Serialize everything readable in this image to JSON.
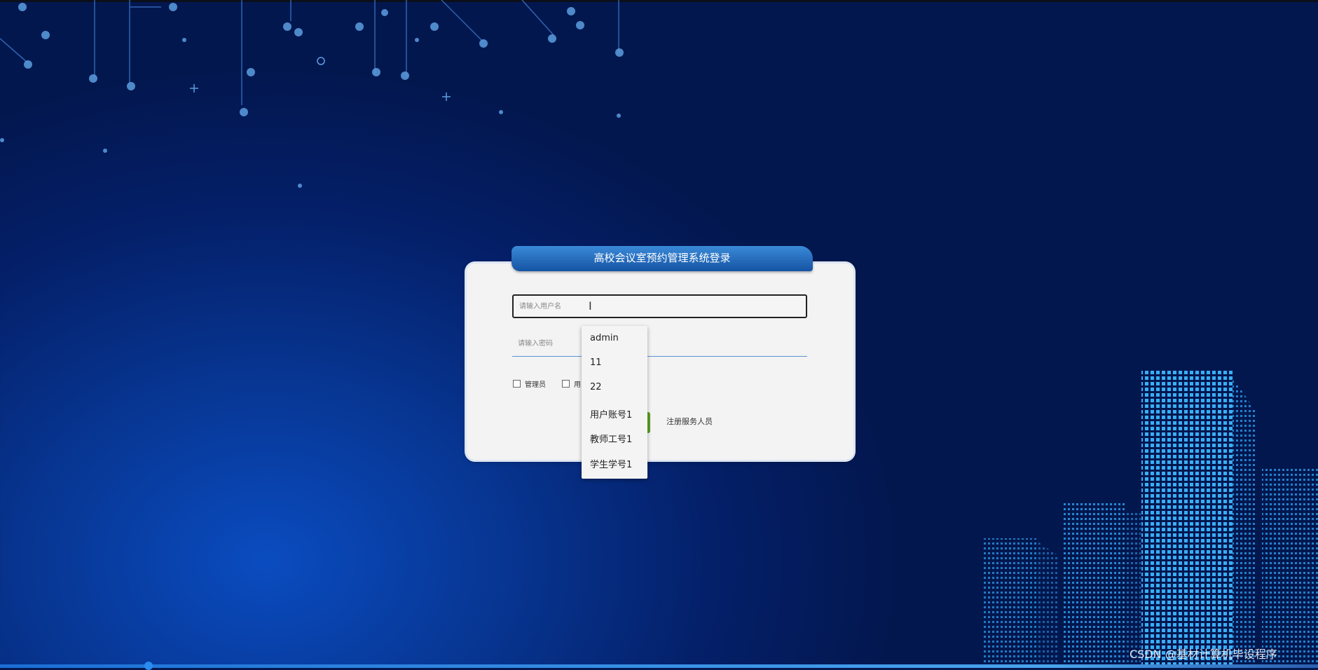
{
  "login": {
    "title": "高校会议室预约管理系统登录",
    "username_placeholder": "请输入用户名",
    "password_placeholder": "请输入密码",
    "roles": [
      "管理员",
      "用"
    ],
    "register_link": "注册服务人员"
  },
  "autocomplete": {
    "items": [
      "admin",
      "11",
      "22",
      "用户账号1",
      "教师工号1",
      "学生学号1"
    ]
  },
  "watermark": "CSDN @基材计算机毕设程序",
  "colors": {
    "panel": "#f3f3f3",
    "title_tab": "#1553a4",
    "button_green": "#5aa024"
  }
}
